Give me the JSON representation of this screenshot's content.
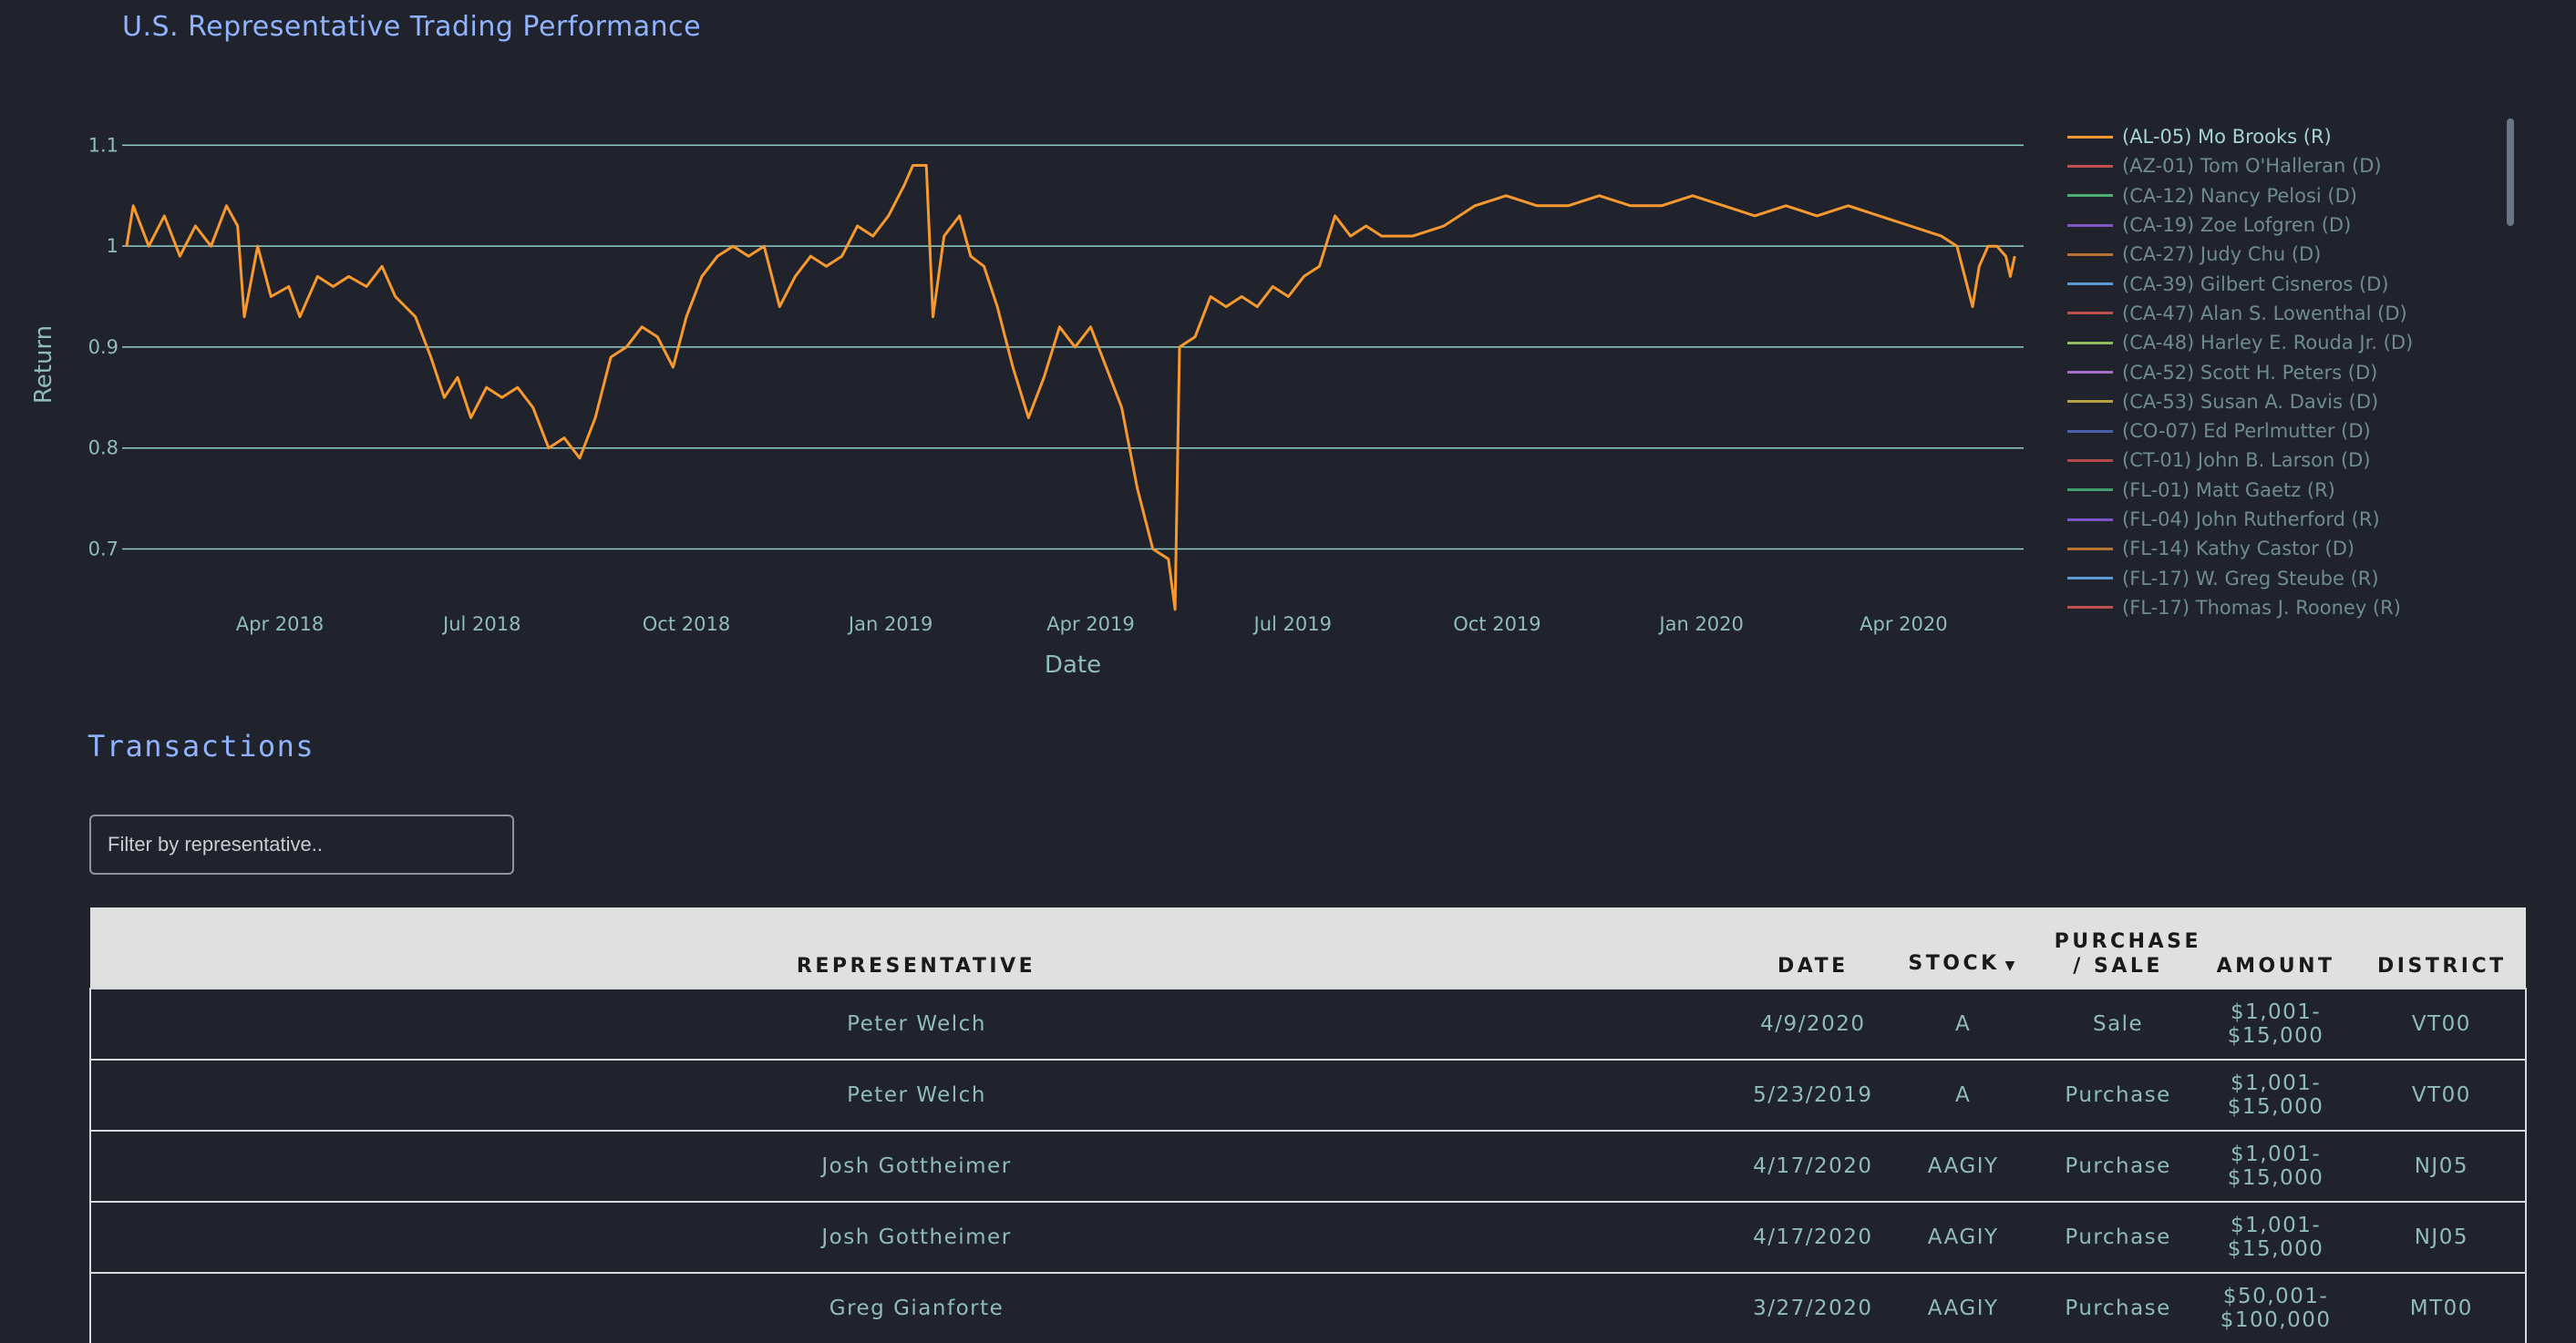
{
  "page": {
    "title": "U.S. Representative Trading Performance"
  },
  "chart_data": {
    "type": "line",
    "title": "",
    "xlabel": "Date",
    "ylabel": "Return",
    "x_ticks": [
      "Apr 2018",
      "Jul 2018",
      "Oct 2018",
      "Jan 2019",
      "Apr 2019",
      "Jul 2019",
      "Oct 2019",
      "Jan 2020",
      "Apr 2020"
    ],
    "y_ticks": [
      0.7,
      0.8,
      0.9,
      1,
      1.1
    ],
    "xlim": [
      "2018-01-20",
      "2020-05-25"
    ],
    "ylim": [
      0.63,
      1.15
    ],
    "grid": true,
    "legend_position": "right",
    "series": [
      {
        "name": "(AL-05)  Mo Brooks (R)",
        "color": "#f7992f",
        "points": [
          [
            "2018-01-22",
            1.0
          ],
          [
            "2018-01-25",
            1.04
          ],
          [
            "2018-02-01",
            1.0
          ],
          [
            "2018-02-08",
            1.03
          ],
          [
            "2018-02-15",
            0.99
          ],
          [
            "2018-02-22",
            1.02
          ],
          [
            "2018-03-01",
            1.0
          ],
          [
            "2018-03-08",
            1.04
          ],
          [
            "2018-03-13",
            1.02
          ],
          [
            "2018-03-16",
            0.93
          ],
          [
            "2018-03-22",
            1.0
          ],
          [
            "2018-03-28",
            0.95
          ],
          [
            "2018-04-05",
            0.96
          ],
          [
            "2018-04-10",
            0.93
          ],
          [
            "2018-04-18",
            0.97
          ],
          [
            "2018-04-25",
            0.96
          ],
          [
            "2018-05-02",
            0.97
          ],
          [
            "2018-05-10",
            0.96
          ],
          [
            "2018-05-17",
            0.98
          ],
          [
            "2018-05-23",
            0.95
          ],
          [
            "2018-06-01",
            0.93
          ],
          [
            "2018-06-08",
            0.89
          ],
          [
            "2018-06-14",
            0.85
          ],
          [
            "2018-06-20",
            0.87
          ],
          [
            "2018-06-26",
            0.83
          ],
          [
            "2018-07-03",
            0.86
          ],
          [
            "2018-07-10",
            0.85
          ],
          [
            "2018-07-17",
            0.86
          ],
          [
            "2018-07-24",
            0.84
          ],
          [
            "2018-07-31",
            0.8
          ],
          [
            "2018-08-07",
            0.81
          ],
          [
            "2018-08-14",
            0.79
          ],
          [
            "2018-08-21",
            0.83
          ],
          [
            "2018-08-28",
            0.89
          ],
          [
            "2018-09-04",
            0.9
          ],
          [
            "2018-09-11",
            0.92
          ],
          [
            "2018-09-18",
            0.91
          ],
          [
            "2018-09-25",
            0.88
          ],
          [
            "2018-10-01",
            0.93
          ],
          [
            "2018-10-08",
            0.97
          ],
          [
            "2018-10-15",
            0.99
          ],
          [
            "2018-10-22",
            1.0
          ],
          [
            "2018-10-29",
            0.99
          ],
          [
            "2018-11-05",
            1.0
          ],
          [
            "2018-11-12",
            0.94
          ],
          [
            "2018-11-19",
            0.97
          ],
          [
            "2018-11-26",
            0.99
          ],
          [
            "2018-12-03",
            0.98
          ],
          [
            "2018-12-10",
            0.99
          ],
          [
            "2018-12-17",
            1.02
          ],
          [
            "2018-12-24",
            1.01
          ],
          [
            "2018-12-31",
            1.03
          ],
          [
            "2019-01-07",
            1.06
          ],
          [
            "2019-01-11",
            1.08
          ],
          [
            "2019-01-17",
            1.08
          ],
          [
            "2019-01-20",
            0.93
          ],
          [
            "2019-01-25",
            1.01
          ],
          [
            "2019-02-01",
            1.03
          ],
          [
            "2019-02-06",
            0.99
          ],
          [
            "2019-02-12",
            0.98
          ],
          [
            "2019-02-18",
            0.94
          ],
          [
            "2019-02-25",
            0.88
          ],
          [
            "2019-03-04",
            0.83
          ],
          [
            "2019-03-11",
            0.87
          ],
          [
            "2019-03-18",
            0.92
          ],
          [
            "2019-03-25",
            0.9
          ],
          [
            "2019-04-01",
            0.92
          ],
          [
            "2019-04-08",
            0.88
          ],
          [
            "2019-04-15",
            0.84
          ],
          [
            "2019-04-22",
            0.76
          ],
          [
            "2019-04-29",
            0.7
          ],
          [
            "2019-05-06",
            0.69
          ],
          [
            "2019-05-09",
            0.64
          ],
          [
            "2019-05-11",
            0.9
          ],
          [
            "2019-05-18",
            0.91
          ],
          [
            "2019-05-25",
            0.95
          ],
          [
            "2019-06-01",
            0.94
          ],
          [
            "2019-06-08",
            0.95
          ],
          [
            "2019-06-15",
            0.94
          ],
          [
            "2019-06-22",
            0.96
          ],
          [
            "2019-06-29",
            0.95
          ],
          [
            "2019-07-06",
            0.97
          ],
          [
            "2019-07-13",
            0.98
          ],
          [
            "2019-07-20",
            1.03
          ],
          [
            "2019-07-27",
            1.01
          ],
          [
            "2019-08-03",
            1.02
          ],
          [
            "2019-08-10",
            1.01
          ],
          [
            "2019-08-24",
            1.01
          ],
          [
            "2019-09-07",
            1.02
          ],
          [
            "2019-09-21",
            1.04
          ],
          [
            "2019-10-05",
            1.05
          ],
          [
            "2019-10-19",
            1.04
          ],
          [
            "2019-11-02",
            1.04
          ],
          [
            "2019-11-16",
            1.05
          ],
          [
            "2019-11-30",
            1.04
          ],
          [
            "2019-12-14",
            1.04
          ],
          [
            "2019-12-28",
            1.05
          ],
          [
            "2020-01-11",
            1.04
          ],
          [
            "2020-01-25",
            1.03
          ],
          [
            "2020-02-08",
            1.04
          ],
          [
            "2020-02-22",
            1.03
          ],
          [
            "2020-03-07",
            1.04
          ],
          [
            "2020-03-21",
            1.03
          ],
          [
            "2020-04-04",
            1.02
          ],
          [
            "2020-04-18",
            1.01
          ],
          [
            "2020-04-25",
            1.0
          ],
          [
            "2020-05-02",
            0.94
          ],
          [
            "2020-05-05",
            0.98
          ],
          [
            "2020-05-09",
            1.0
          ],
          [
            "2020-05-13",
            1.0
          ],
          [
            "2020-05-17",
            0.99
          ],
          [
            "2020-05-19",
            0.97
          ],
          [
            "2020-05-21",
            0.99
          ]
        ]
      }
    ]
  },
  "legend": [
    {
      "label": "(AL-05)  Mo Brooks (R)",
      "color": "#f7992f",
      "active": true
    },
    {
      "label": "(AZ-01)  Tom O'Halleran (D)",
      "color": "#c0504d",
      "active": false
    },
    {
      "label": "(CA-12)  Nancy Pelosi (D)",
      "color": "#4caf70",
      "active": false
    },
    {
      "label": "(CA-19)  Zoe Lofgren (D)",
      "color": "#7e57c2",
      "active": false
    },
    {
      "label": "(CA-27)  Judy Chu (D)",
      "color": "#b87333",
      "active": false
    },
    {
      "label": "(CA-39)  Gilbert Cisneros (D)",
      "color": "#5b9bd5",
      "active": false
    },
    {
      "label": "(CA-47)  Alan S. Lowenthal (D)",
      "color": "#c0504d",
      "active": false
    },
    {
      "label": "(CA-48)  Harley E. Rouda Jr. (D)",
      "color": "#8fbc5a",
      "active": false
    },
    {
      "label": "(CA-52)  Scott H. Peters (D)",
      "color": "#a56ec4",
      "active": false
    },
    {
      "label": "(CA-53)  Susan A. Davis (D)",
      "color": "#b8a045",
      "active": false
    },
    {
      "label": "(CO-07)  Ed Perlmutter (D)",
      "color": "#4a5fb0",
      "active": false
    },
    {
      "label": "(CT-01)  John B. Larson (D)",
      "color": "#b04a4a",
      "active": false
    },
    {
      "label": "(FL-01)  Matt Gaetz (R)",
      "color": "#3f9e6e",
      "active": false
    },
    {
      "label": "(FL-04)  John Rutherford (R)",
      "color": "#7a55c8",
      "active": false
    },
    {
      "label": "(FL-14)  Kathy Castor (D)",
      "color": "#b87333",
      "active": false
    },
    {
      "label": "(FL-17)  W. Greg Steube (R)",
      "color": "#5b9bd5",
      "active": false
    },
    {
      "label": "(FL-17)  Thomas J. Rooney (R)",
      "color": "#c0504d",
      "active": false
    }
  ],
  "transactions": {
    "title": "Transactions",
    "filter_placeholder": "Filter by representative..",
    "columns": [
      {
        "label": "REPRESENTATIVE",
        "sorted": false
      },
      {
        "label": "DATE",
        "sorted": false
      },
      {
        "label": "STOCK",
        "sorted": true,
        "sort_arrow": "▼"
      },
      {
        "label": "PURCHASE / SALE",
        "sorted": false
      },
      {
        "label": "AMOUNT",
        "sorted": false
      },
      {
        "label": "DISTRICT",
        "sorted": false
      }
    ],
    "rows": [
      {
        "representative": "Peter Welch",
        "date": "4/9/2020",
        "stock": "A",
        "type": "Sale",
        "amount": "$1,001-$15,000",
        "district": "VT00"
      },
      {
        "representative": "Peter Welch",
        "date": "5/23/2019",
        "stock": "A",
        "type": "Purchase",
        "amount": "$1,001-$15,000",
        "district": "VT00"
      },
      {
        "representative": "Josh Gottheimer",
        "date": "4/17/2020",
        "stock": "AAGIY",
        "type": "Purchase",
        "amount": "$1,001-$15,000",
        "district": "NJ05"
      },
      {
        "representative": "Josh Gottheimer",
        "date": "4/17/2020",
        "stock": "AAGIY",
        "type": "Purchase",
        "amount": "$1,001-$15,000",
        "district": "NJ05"
      },
      {
        "representative": "Greg Gianforte",
        "date": "3/27/2020",
        "stock": "AAGIY",
        "type": "Purchase",
        "amount": "$50,001-$100,000",
        "district": "MT00"
      }
    ]
  },
  "colors": {
    "background": "#20232b",
    "accent": "#8fb3ff",
    "text": "#8fbcbb",
    "grid": "#8fd0c8",
    "line": "#f7992f",
    "header_bg": "#e0e0e0"
  }
}
